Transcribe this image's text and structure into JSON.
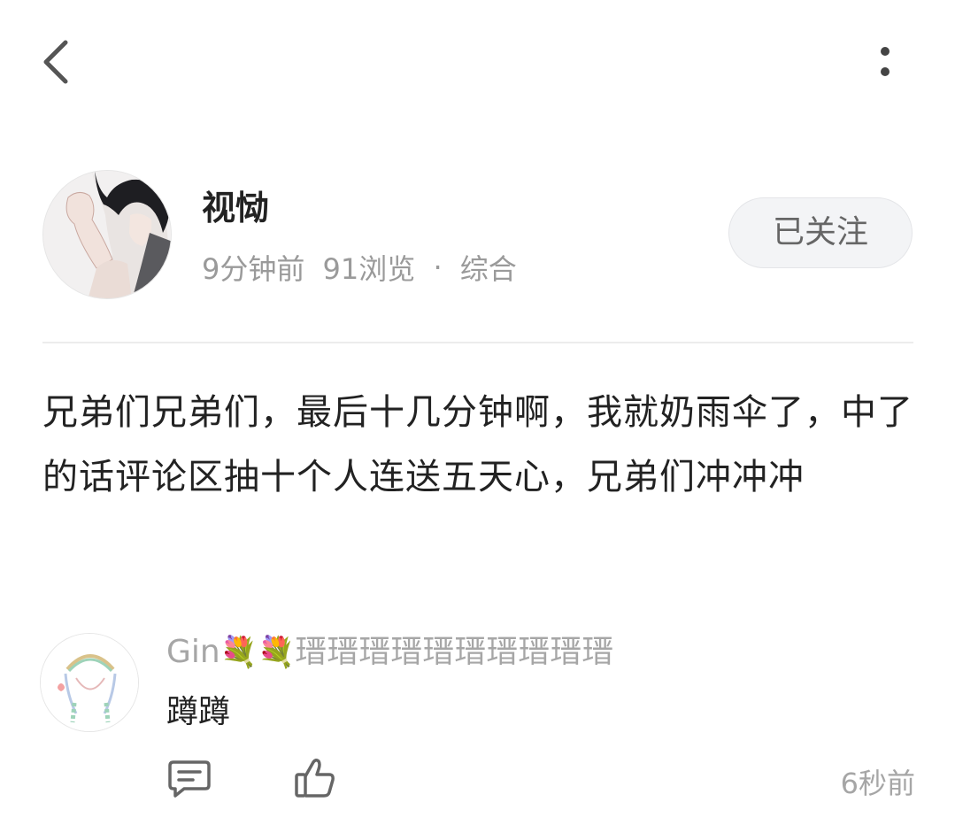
{
  "header": {
    "back_icon": "chevron-left-icon",
    "more_icon": "vertical-ellipsis-icon"
  },
  "author": {
    "name": "视恸",
    "time": "9分钟前",
    "views": "91浏览",
    "separator": "·",
    "category": "综合",
    "follow_label": "已关注"
  },
  "post": {
    "text": "兄弟们兄弟们，最后十几分钟啊，我就奶雨伞了，中了的话评论区抽十个人连送五天心，兄弟们冲冲冲"
  },
  "comment": {
    "name_prefix": "Gin",
    "flower_1": "💐",
    "flower_2": "💐",
    "name_suffix": "瑨瑨瑨瑨瑨瑨瑨瑨瑨瑨",
    "text": "蹲蹲",
    "time": "6秒前",
    "reply_icon": "comment-icon",
    "like_icon": "thumbs-up-icon"
  },
  "colors": {
    "secondary_text": "#9a9a9a",
    "follow_bg": "#f3f4f6"
  }
}
